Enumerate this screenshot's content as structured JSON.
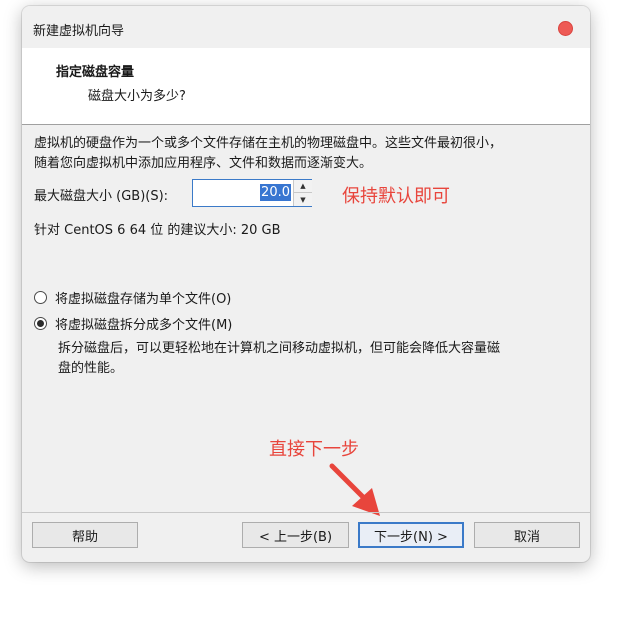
{
  "window": {
    "title": "新建虚拟机向导"
  },
  "header": {
    "title": "指定磁盘容量",
    "subtitle": "磁盘大小为多少?"
  },
  "description": [
    "虚拟机的硬盘作为一个或多个文件存储在主机的物理磁盘中。这些文件最初很小，",
    "随着您向虚拟机中添加应用程序、文件和数据而逐渐变大。"
  ],
  "disk_size": {
    "label": "最大磁盘大小 (GB)(S):",
    "value": "20.0"
  },
  "recommendation": "针对 CentOS 6 64 位 的建议大小: 20 GB",
  "options": [
    {
      "label": "将虚拟磁盘存储为单个文件(O)",
      "checked": false
    },
    {
      "label": "将虚拟磁盘拆分成多个文件(M)",
      "checked": true
    }
  ],
  "split_description": [
    "拆分磁盘后，可以更轻松地在计算机之间移动虚拟机，但可能会降低大容量磁",
    "盘的性能。"
  ],
  "annotations": {
    "keep_default": "保持默认即可",
    "next_step": "直接下一步"
  },
  "buttons": {
    "help": "帮助",
    "back": "< 上一步(B)",
    "next": "下一步(N) >",
    "cancel": "取消"
  },
  "colors": {
    "annotation": "#e8453c",
    "accent": "#3b7ac8",
    "close": "#ee5a55"
  }
}
